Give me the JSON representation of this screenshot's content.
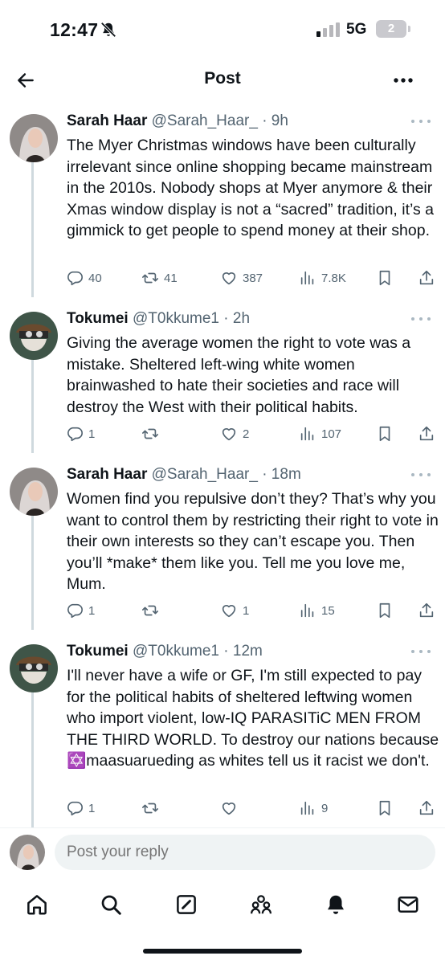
{
  "status_bar": {
    "time": "12:47",
    "network": "5G",
    "battery": "2"
  },
  "header": {
    "title": "Post"
  },
  "tweets": [
    {
      "name": "Sarah Haar",
      "meta": " @Sarah_Haar_ · 9h",
      "text": "The Myer Christmas windows have been culturally irrelevant since online shopping became mainstream in the 2010s. Nobody shops at Myer anymore & their Xmas window display is not a “sacred” tradition, it’s a gimmick to get people to spend money at their shop.",
      "replies": "40",
      "reposts": "41",
      "likes": "387",
      "views": "7.8K"
    },
    {
      "name": "Tokumei",
      "meta": " @T0kkume1 · 2h",
      "text": "Giving the average women the right to vote was a mistake.  Sheltered left-wing white women brainwashed to hate their societies and race will destroy the West with their political habits.",
      "replies": "1",
      "reposts": "",
      "likes": "2",
      "views": "107"
    },
    {
      "name": "Sarah Haar",
      "meta": " @Sarah_Haar_ · 18m",
      "text": "Women find you repulsive don’t they? That’s why you want to control them by restricting their right to vote in their own interests so they can’t escape you. Then you’ll *make* them like you. Tell me you love me, Mum.",
      "replies": "1",
      "reposts": "",
      "likes": "1",
      "views": "15"
    },
    {
      "name": "Tokumei",
      "meta": " @T0kkume1 · 12m",
      "text_before_emoji": "I'll never have a wife or GF, I'm still expected to pay for the political habits of sheltered leftwing women who import violent, low-IQ PARASITiC MEN FROM THE THIRD WORLD. To destroy our nations because ",
      "text_after_emoji": "maasuarueding as whites tell us it racist we don't.",
      "emoji": "✡️",
      "replies": "1",
      "reposts": "",
      "likes": "",
      "views": "9"
    }
  ],
  "reply": {
    "placeholder": "Post your reply"
  },
  "icons": {
    "back": "arrow-left-icon",
    "more": "more-horizontal-icon",
    "reply": "comment-icon",
    "repost": "repost-icon",
    "like": "heart-icon",
    "views": "views-chart-icon",
    "bookmark": "bookmark-icon",
    "share": "share-icon",
    "tabs": [
      "home-icon",
      "search-icon",
      "compose-icon",
      "communities-icon",
      "notifications-icon",
      "messages-icon"
    ]
  },
  "colors": {
    "text": "#0f1419",
    "secondary": "#536471",
    "thread_line": "#cfd9de",
    "input_bg": "#eff3f4"
  }
}
